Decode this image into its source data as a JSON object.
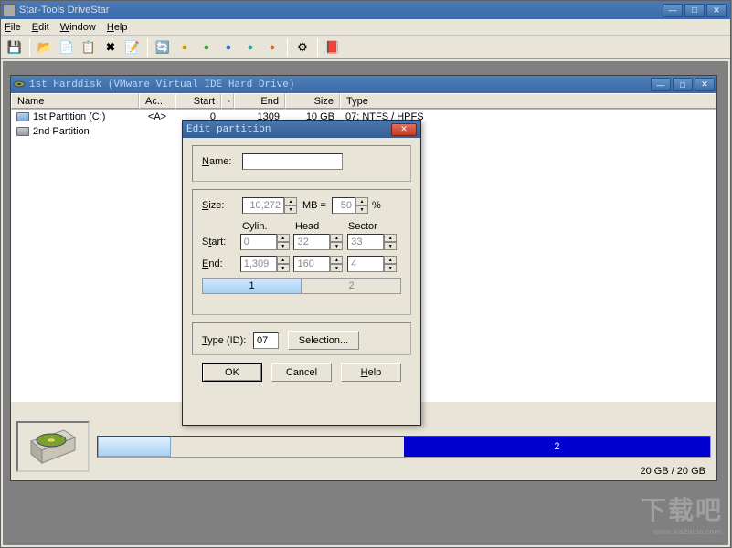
{
  "app": {
    "title": "Star-Tools DriveStar"
  },
  "menu": {
    "file": "File",
    "edit": "Edit",
    "window": "Window",
    "help": "Help"
  },
  "toolbar": {
    "icons": [
      "floppy-icon",
      "open-icon",
      "copy-icon",
      "paste-icon",
      "delete-icon",
      "properties-icon",
      "refresh-icon",
      "disk-yellow-icon",
      "disk-green-icon",
      "disk-blue-icon",
      "disk-teal-icon",
      "disk-orange-icon",
      "options-icon",
      "help-icon"
    ]
  },
  "child": {
    "title": "1st Harddisk (VMware Virtual IDE Hard Drive)",
    "columns": {
      "name": "Name",
      "active": "Ac...",
      "start": "Start",
      "dot": "·",
      "end": "End",
      "size": "Size",
      "type": "Type"
    },
    "rows": [
      {
        "name": "1st Partition (C:)",
        "active": "<A>",
        "start": "0",
        "dot": "",
        "end": "1309",
        "size": "10 GB",
        "type": "07: NTFS / HPFS"
      },
      {
        "name": "2nd Partition",
        "active": "",
        "start": "",
        "dot": "",
        "end": "",
        "size": "",
        "type": ""
      }
    ],
    "bar": {
      "seg1": "",
      "seg2": "2"
    },
    "disk_size": "20 GB / 20 GB"
  },
  "dialog": {
    "title": "Edit partition",
    "name_label": "Name:",
    "name_value": "",
    "size_label": "Size:",
    "size_value": "10,272",
    "mb_eq": "MB  =",
    "percent_value": "50",
    "percent_sym": "%",
    "col_cylin": "Cylin.",
    "col_head": "Head",
    "col_sector": "Sector",
    "start_label": "Start:",
    "start": {
      "c": "0",
      "h": "32",
      "s": "33"
    },
    "end_label": "End:",
    "end": {
      "c": "1,309",
      "h": "160",
      "s": "4"
    },
    "tab1": "1",
    "tab2": "2",
    "type_label": "Type (ID):",
    "type_value": "07",
    "selection_btn": "Selection...",
    "ok": "OK",
    "cancel": "Cancel",
    "help": "Help"
  },
  "watermark": {
    "big": "下载吧",
    "small": "www.xiazaiba.com"
  }
}
